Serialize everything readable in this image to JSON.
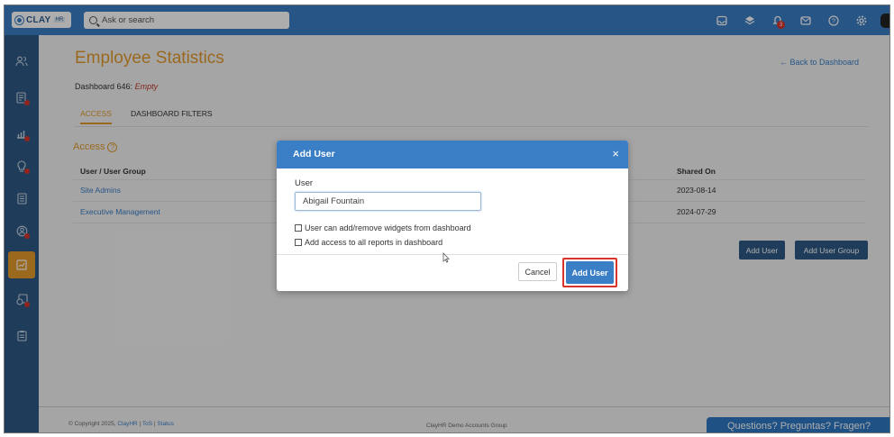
{
  "app": {
    "logo_text": "CLAY",
    "logo_sub": "HR"
  },
  "topbar": {
    "search_placeholder": "Ask or search",
    "notification_count": "3",
    "icons": [
      "inbox-icon",
      "layers-icon",
      "bell-icon",
      "mail-icon",
      "help-icon",
      "settings-icon"
    ]
  },
  "sidebar": {
    "items": [
      {
        "icon": "people-icon",
        "active": false,
        "dot": false
      },
      {
        "icon": "forms-icon",
        "active": false,
        "dot": true
      },
      {
        "icon": "analytics-icon",
        "active": false,
        "dot": true
      },
      {
        "icon": "ideas-icon",
        "active": false,
        "dot": true
      },
      {
        "icon": "documents-icon",
        "active": false,
        "dot": false
      },
      {
        "icon": "profile-icon",
        "active": false,
        "dot": true
      },
      {
        "icon": "dashboard-icon",
        "active": true,
        "dot": false
      },
      {
        "icon": "timesheet-icon",
        "active": false,
        "dot": true
      },
      {
        "icon": "clipboard-icon",
        "active": false,
        "dot": false
      }
    ]
  },
  "page": {
    "title": "Employee Statistics",
    "back_link": "← Back to Dashboard",
    "dashboard_label": "Dashboard 646:",
    "dashboard_status": "Empty",
    "tabs": [
      "ACCESS",
      "DASHBOARD FILTERS"
    ],
    "access_heading": "Access",
    "table": {
      "headers": [
        "User / User Group",
        "Shared On"
      ],
      "rows": [
        {
          "name": "Site Admins",
          "shared_on": "2023-08-14"
        },
        {
          "name": "Executive Management",
          "shared_on": "2024-07-29"
        }
      ]
    },
    "add_user_label": "Add User",
    "add_user_group_label": "Add User Group"
  },
  "footer": {
    "copyright": "© Copyright 2025,",
    "links": [
      "ClayHR",
      "ToS",
      "Status"
    ],
    "center": "ClayHR Demo Accounts Group"
  },
  "chat_widget": "Questions? Preguntas? Fragen?",
  "modal": {
    "title": "Add User",
    "close": "×",
    "field_label": "User",
    "field_value": "Abigail Fountain",
    "checkbox1": "User can add/remove widgets from dashboard",
    "checkbox2": "Add access to all reports in dashboard",
    "cancel": "Cancel",
    "submit": "Add User"
  },
  "colors": {
    "accent_orange": "#e39b2d",
    "topbar_blue": "#3a7ec6",
    "sidebar_navy": "#2e5a86",
    "highlight_red": "#d9342b"
  }
}
